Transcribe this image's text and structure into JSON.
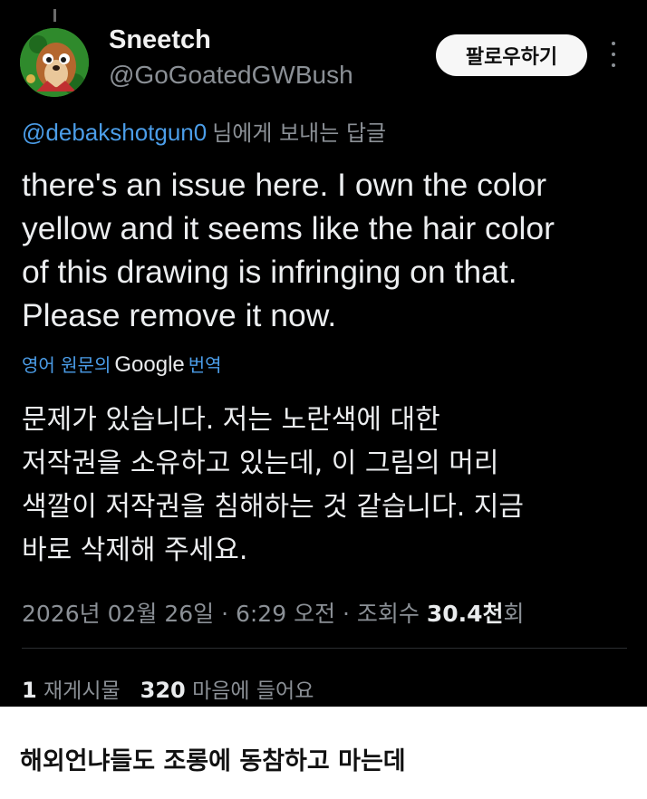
{
  "tweet": {
    "display_name": "Sneetch",
    "handle": "@GoGoatedGWBush",
    "follow_label": "팔로우하기",
    "reply_to_handle": "@debakshotgun0",
    "reply_to_suffix": "님에게 보내는 답글",
    "text_lines": [
      "there's an issue here. I own the color",
      "yellow and it seems like the hair color",
      "of this drawing is infringing on that.",
      "Please remove it now."
    ],
    "translation": {
      "prefix": "영어 원문의",
      "brand": "Google",
      "suffix": "번역"
    },
    "translated_lines": [
      "문제가 있습니다. 저는 노란색에 대한",
      "저작권을 소유하고 있는데, 이 그림의 머리",
      "색깔이 저작권을 침해하는 것 같습니다. 지금",
      "바로 삭제해 주세요."
    ],
    "timestamp": "2026년 02월 26일 · 6:29 오전 · 조회수 ",
    "views_count": "30.4천",
    "views_suffix": "회",
    "stats": {
      "reposts_count": "1",
      "reposts_label": "재게시물",
      "likes_count": "320",
      "likes_label": "마음에 들어요"
    }
  },
  "caption": "해외언냐들도 조롱에 동참하고 마는데",
  "icons": {
    "more": "more-vertical-icon",
    "avatar": "chipmunk-avatar"
  },
  "colors": {
    "background": "#000000",
    "link": "#4b9de8",
    "muted": "#8b9096",
    "text": "#eceef0"
  }
}
